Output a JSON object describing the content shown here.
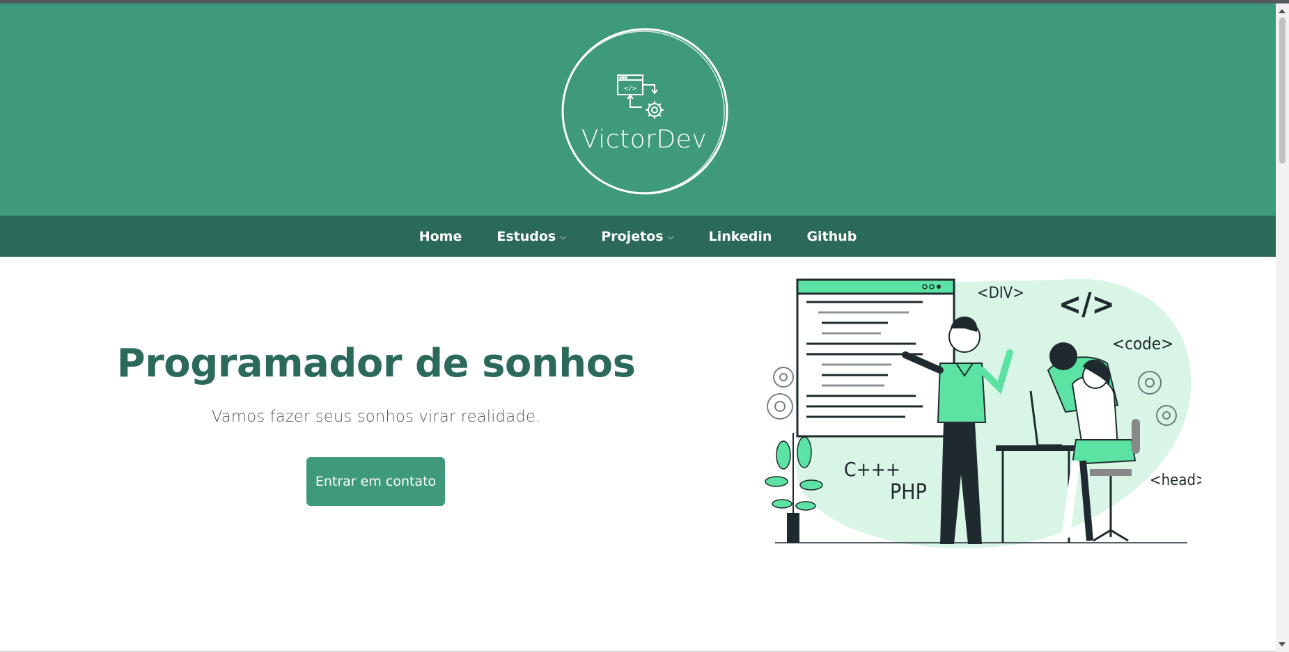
{
  "brand": {
    "name": "VictorDev",
    "logo_icon": "code-window-gear-icon"
  },
  "nav": {
    "items": [
      {
        "label": "Home",
        "dropdown": false
      },
      {
        "label": "Estudos",
        "dropdown": true
      },
      {
        "label": "Projetos",
        "dropdown": true
      },
      {
        "label": "Linkedin",
        "dropdown": false
      },
      {
        "label": "Github",
        "dropdown": false
      }
    ]
  },
  "hero": {
    "title": "Programador de sonhos",
    "subtitle": "Vamos fazer seus sonhos virar realidade.",
    "cta_label": "Entrar em contato"
  },
  "illustration": {
    "tags": [
      "<DIV>",
      "</>",
      "<code>",
      "C+++",
      "PHP",
      "<head>"
    ]
  },
  "colors": {
    "header_bg": "#3e9a7a",
    "nav_bg": "#2b6a5a",
    "title": "#2b6a5a",
    "accent_light": "#d8f5e6",
    "accent_green": "#5ce2a3",
    "dark": "#1e2a2e"
  }
}
